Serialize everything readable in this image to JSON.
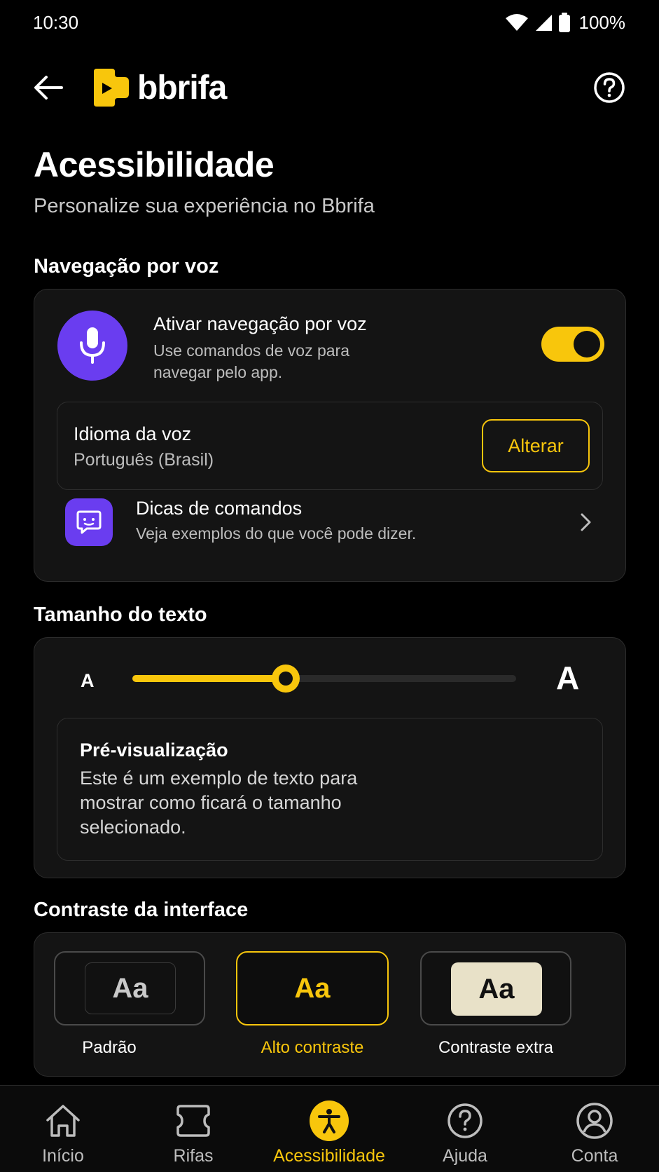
{
  "status_bar": {
    "time": "10:30",
    "battery": "100%"
  },
  "header": {
    "logo_text": "bbrifa"
  },
  "page": {
    "title": "Acessibilidade",
    "subtitle": "Personalize sua experiência no Bbrifa"
  },
  "voice_section": {
    "title": "Navegação por voz",
    "toggle_title": "Ativar navegação por voz",
    "toggle_desc": "Use comandos de voz para navegar pelo app.",
    "toggle_on": true,
    "language_title": "Idioma da voz",
    "language_value": "Português (Brasil)",
    "change_label": "Alterar",
    "tips_title": "Dicas de comandos",
    "tips_desc": "Veja exemplos do que você pode dizer."
  },
  "text_size": {
    "title": "Tamanho do texto",
    "small_label": "A",
    "large_label": "A",
    "level": 0.4,
    "preview_title": "Pré-visualização",
    "preview_text": "Este é um exemplo de texto para mostrar como ficará o tamanho selecionado."
  },
  "contrast": {
    "title": "Contraste da interface",
    "selected": "Alto contraste",
    "options": [
      {
        "sample": "Aa",
        "label": "Padrão"
      },
      {
        "sample": "Aa",
        "label": "Alto contraste"
      },
      {
        "sample": "Aa",
        "label": "Contraste extra"
      }
    ]
  },
  "bottom_nav": [
    {
      "label": "Início",
      "icon": "home-icon"
    },
    {
      "label": "Rifas",
      "icon": "ticket-icon"
    },
    {
      "label": "Acessibilidade",
      "icon": "accessibility-icon",
      "active": true
    },
    {
      "label": "Ajuda",
      "icon": "help-icon"
    },
    {
      "label": "Conta",
      "icon": "account-icon"
    }
  ],
  "colors": {
    "accent": "#f8c60c",
    "purple": "#6a3df0",
    "background": "#000000",
    "card": "#141414"
  }
}
